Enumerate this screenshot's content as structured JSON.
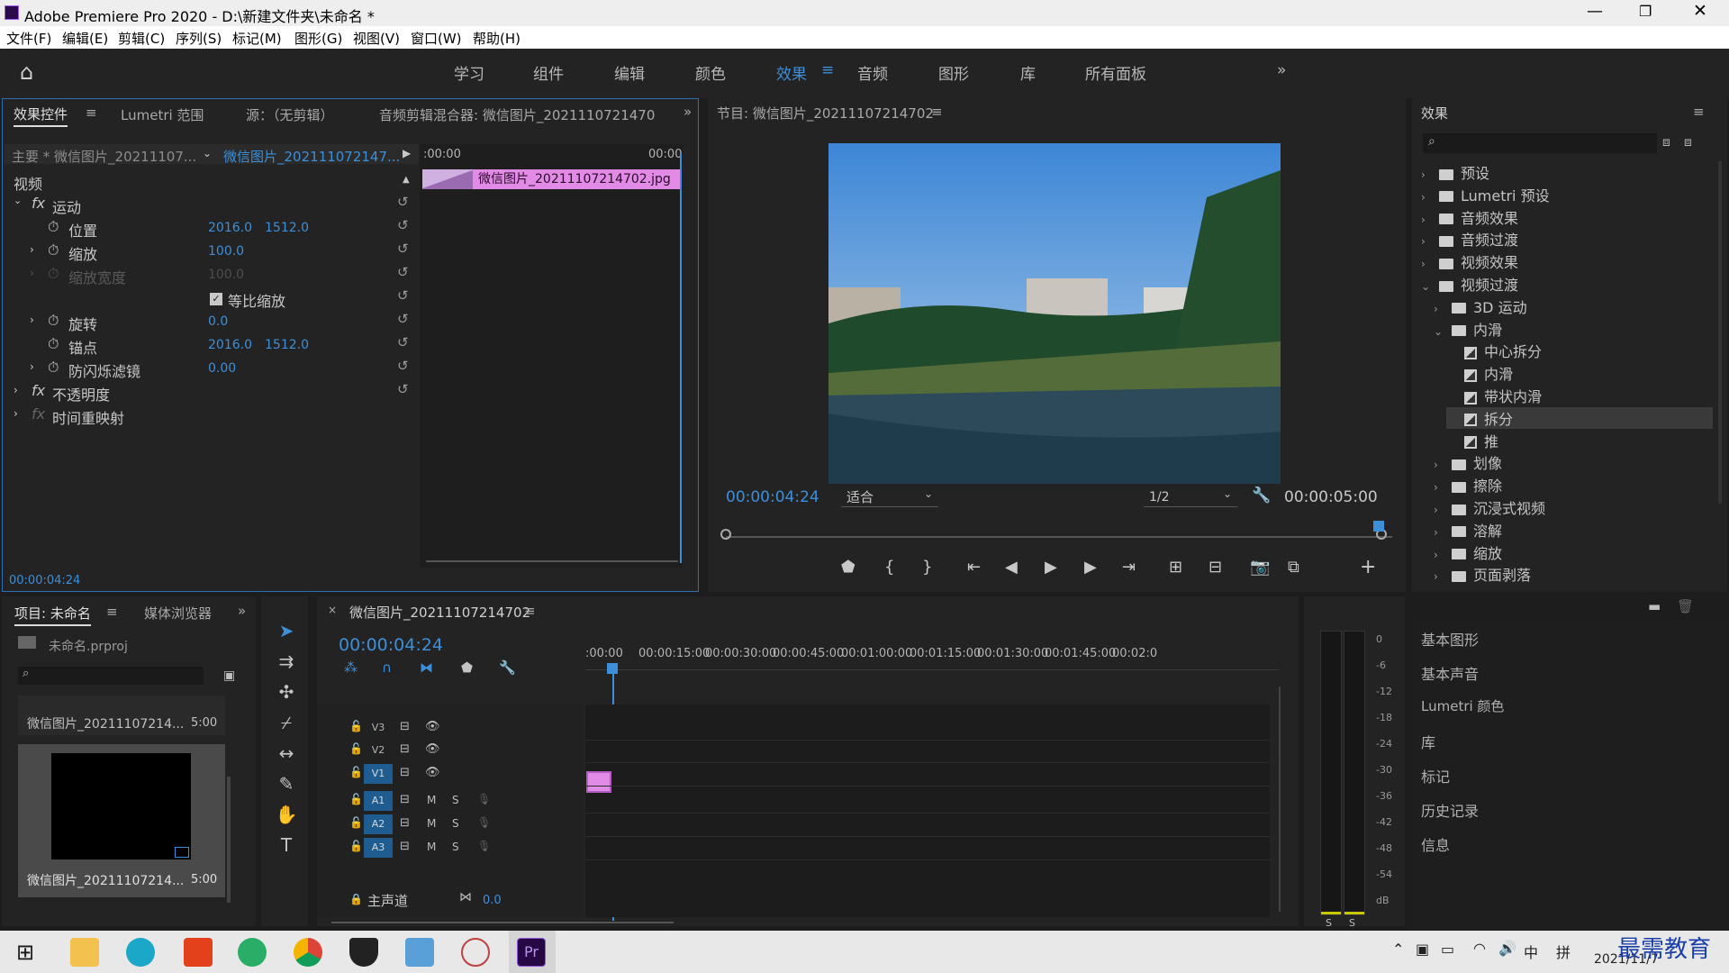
{
  "window": {
    "title": "Adobe Premiere Pro 2020 - D:\\新建文件夹\\未命名 *",
    "controls": [
      "minimize",
      "restore",
      "close"
    ]
  },
  "menu": [
    "文件(F)",
    "编辑(E)",
    "剪辑(C)",
    "序列(S)",
    "标记(M)",
    "图形(G)",
    "视图(V)",
    "窗口(W)",
    "帮助(H)"
  ],
  "workspaces": [
    "学习",
    "组件",
    "编辑",
    "颜色",
    "效果",
    "音频",
    "图形",
    "库",
    "所有面板"
  ],
  "active_workspace": "效果",
  "effect_controls": {
    "tabs": [
      "效果控件",
      "Lumetri 范围",
      "源：（无剪辑）",
      "音频剪辑混合器: 微信图片_2021110721470"
    ],
    "master_label": "主要 * 微信图片_20211107...",
    "clip_label": "微信图片_202111072147...",
    "section_video": "视频",
    "motion": "运动",
    "position_label": "位置",
    "position_x": "2016.0",
    "position_y": "1512.0",
    "scale_label": "缩放",
    "scale_value": "100.0",
    "scale_width_label": "缩放宽度",
    "scale_width_value": "100.0",
    "uniform_scale": "等比缩放",
    "rotation_label": "旋转",
    "rotation_value": "0.0",
    "anchor_label": "锚点",
    "anchor_x": "2016.0",
    "anchor_y": "1512.0",
    "anti_flicker_label": "防闪烁滤镜",
    "anti_flicker_value": "0.00",
    "opacity": "不透明度",
    "time_remap": "时间重映射",
    "ruler_start": ":00:00",
    "ruler_end": "00:00",
    "clip_name": "微信图片_20211107214702.jpg",
    "timecode": "00:00:04:24"
  },
  "program_monitor": {
    "title": "节目: 微信图片_20211107214702",
    "timecode": "00:00:04:24",
    "fit": "适合",
    "resolution": "1/2",
    "duration": "00:00:05:00",
    "playhead_progress": 0.98
  },
  "effects_panel": {
    "title": "效果",
    "tree": [
      {
        "label": "预设",
        "level": 0,
        "type": "folder",
        "expanded": false
      },
      {
        "label": "Lumetri 预设",
        "level": 0,
        "type": "folder",
        "expanded": false
      },
      {
        "label": "音频效果",
        "level": 0,
        "type": "folder",
        "expanded": false
      },
      {
        "label": "音频过渡",
        "level": 0,
        "type": "folder",
        "expanded": false
      },
      {
        "label": "视频效果",
        "level": 0,
        "type": "folder",
        "expanded": false
      },
      {
        "label": "视频过渡",
        "level": 0,
        "type": "folder",
        "expanded": true
      },
      {
        "label": "3D 运动",
        "level": 1,
        "type": "folder",
        "expanded": false
      },
      {
        "label": "内滑",
        "level": 1,
        "type": "folder",
        "expanded": true
      },
      {
        "label": "中心拆分",
        "level": 2,
        "type": "transition"
      },
      {
        "label": "内滑",
        "level": 2,
        "type": "transition"
      },
      {
        "label": "带状内滑",
        "level": 2,
        "type": "transition"
      },
      {
        "label": "拆分",
        "level": 2,
        "type": "transition",
        "selected": true
      },
      {
        "label": "推",
        "level": 2,
        "type": "transition"
      },
      {
        "label": "划像",
        "level": 1,
        "type": "folder",
        "expanded": false
      },
      {
        "label": "擦除",
        "level": 1,
        "type": "folder",
        "expanded": false
      },
      {
        "label": "沉浸式视频",
        "level": 1,
        "type": "folder",
        "expanded": false
      },
      {
        "label": "溶解",
        "level": 1,
        "type": "folder",
        "expanded": false
      },
      {
        "label": "缩放",
        "level": 1,
        "type": "folder",
        "expanded": false
      },
      {
        "label": "页面剥落",
        "level": 1,
        "type": "folder",
        "expanded": false
      }
    ],
    "side_panels": [
      "基本图形",
      "基本声音",
      "Lumetri 颜色",
      "库",
      "标记",
      "历史记录",
      "信息"
    ]
  },
  "project_panel": {
    "tabs": [
      "项目: 未命名",
      "媒体浏览器"
    ],
    "project_file": "未命名.prproj",
    "items": [
      {
        "name": "微信图片_20211107214...",
        "duration": "5:00"
      },
      {
        "name": "微信图片_20211107214...",
        "duration": "5:00"
      }
    ]
  },
  "timeline": {
    "title": "微信图片_20211107214702",
    "timecode": "00:00:04:24",
    "ruler": [
      ":00:00",
      "00:00:15:00",
      "00:00:30:00",
      "00:00:45:00",
      "00:01:00:00",
      "00:01:15:00",
      "00:01:30:00",
      "00:01:45:00",
      "00:02:0"
    ],
    "video_tracks": [
      "V3",
      "V2",
      "V1"
    ],
    "audio_tracks": [
      "A1",
      "A2",
      "A3"
    ],
    "mute": "M",
    "solo": "S",
    "master_label": "主声道",
    "master_value": "0.0"
  },
  "audio_meter": {
    "scale": [
      "0",
      "-6",
      "-12",
      "-18",
      "-24",
      "-30",
      "-36",
      "-42",
      "-48",
      "-54",
      "dB"
    ],
    "solo_labels": [
      "S",
      "S"
    ]
  },
  "taskbar": {
    "clock_date": "2021/11/7",
    "ime": "中",
    "watermark": "最需教育"
  }
}
